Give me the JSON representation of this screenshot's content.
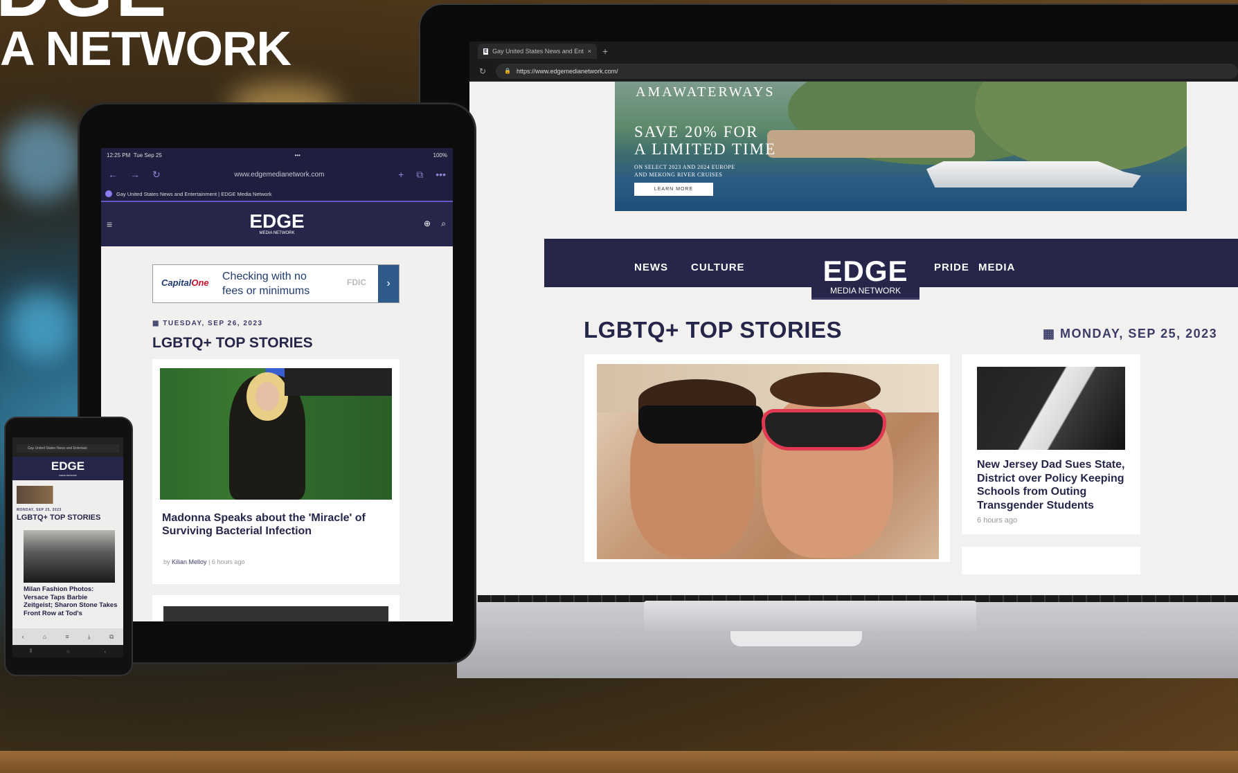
{
  "marketing": {
    "brand_fragment": "DGE",
    "subtitle": "A NETWORK"
  },
  "laptop": {
    "browser": {
      "tab_title": "Gay United States News and Ent",
      "favicon": "E",
      "new_tab_icon": "+",
      "reload_icon": "↻",
      "lock_icon": "🔒",
      "url": "https://www.edgemedianetwork.com/"
    },
    "ad": {
      "brand": "AMAWATERWAYS",
      "headline_line1": "SAVE 20% FOR",
      "headline_line2": "A LIMITED TIME",
      "fine_line1": "ON SELECT 2023 AND 2024 EUROPE",
      "fine_line2": "AND MEKONG RIVER CRUISES",
      "button": "LEARN MORE"
    },
    "nav": {
      "news": "NEWS",
      "culture": "CULTURE",
      "pride": "PRIDE",
      "media": "MEDIA",
      "logo": "EDGE",
      "logo_sub": "MEDIA NETWORK"
    },
    "section_title": "LGBTQ+ TOP STORIES",
    "date": "MONDAY, SEP 25, 2023",
    "calendar_icon": "▦",
    "side_story": {
      "headline": "New Jersey Dad Sues State, District over Policy Keeping Schools from Outing Transgender Students",
      "meta": "6 hours ago"
    }
  },
  "tablet": {
    "status": {
      "time": "12:25 PM",
      "day": "Tue Sep 25",
      "dots": "•••",
      "battery": "100%"
    },
    "toolbar": {
      "back": "←",
      "forward": "→",
      "reload": "↻",
      "url": "www.edgemedianetwork.com",
      "add": "+",
      "tabs": "⧉",
      "more": "•••"
    },
    "tab_title": "Gay United States News and Entertainment | EDGE Media Network",
    "header": {
      "menu_icon": "≡",
      "logo": "EDGE",
      "logo_sub": "MEDIA NETWORK",
      "globe_icon": "⊕",
      "search_icon": "⌕"
    },
    "ad": {
      "brand_main": "Capital",
      "brand_accent": "One",
      "line1": "Checking with no",
      "line2": "fees or minimums",
      "fdic": "FDIC",
      "arrow": "›"
    },
    "date": "TUESDAY, SEP 26, 2023",
    "section_title": "LGBTQ+ TOP STORIES",
    "story": {
      "headline": "Madonna Speaks about the 'Miracle' of Surviving Bacterial Infection",
      "by": "by",
      "author": "Kilian Melloy",
      "time": "| 6 hours ago"
    }
  },
  "phone": {
    "url": "Gay United States News and Entertain",
    "logo": "EDGE",
    "logo_sub": "MEDIA NETWORK",
    "date": "MONDAY, SEP 25, 2023",
    "section_title": "LGBTQ+ TOP STORIES",
    "headline": "Milan Fashion Photos: Versace Taps Barbie Zeitgeist; Sharon Stone Takes Front Row at Tod's",
    "nav": [
      "‹",
      "⌂",
      "≡",
      "⤓",
      "⧉"
    ],
    "home_bar": [
      "⦀",
      "○",
      "‹"
    ]
  }
}
